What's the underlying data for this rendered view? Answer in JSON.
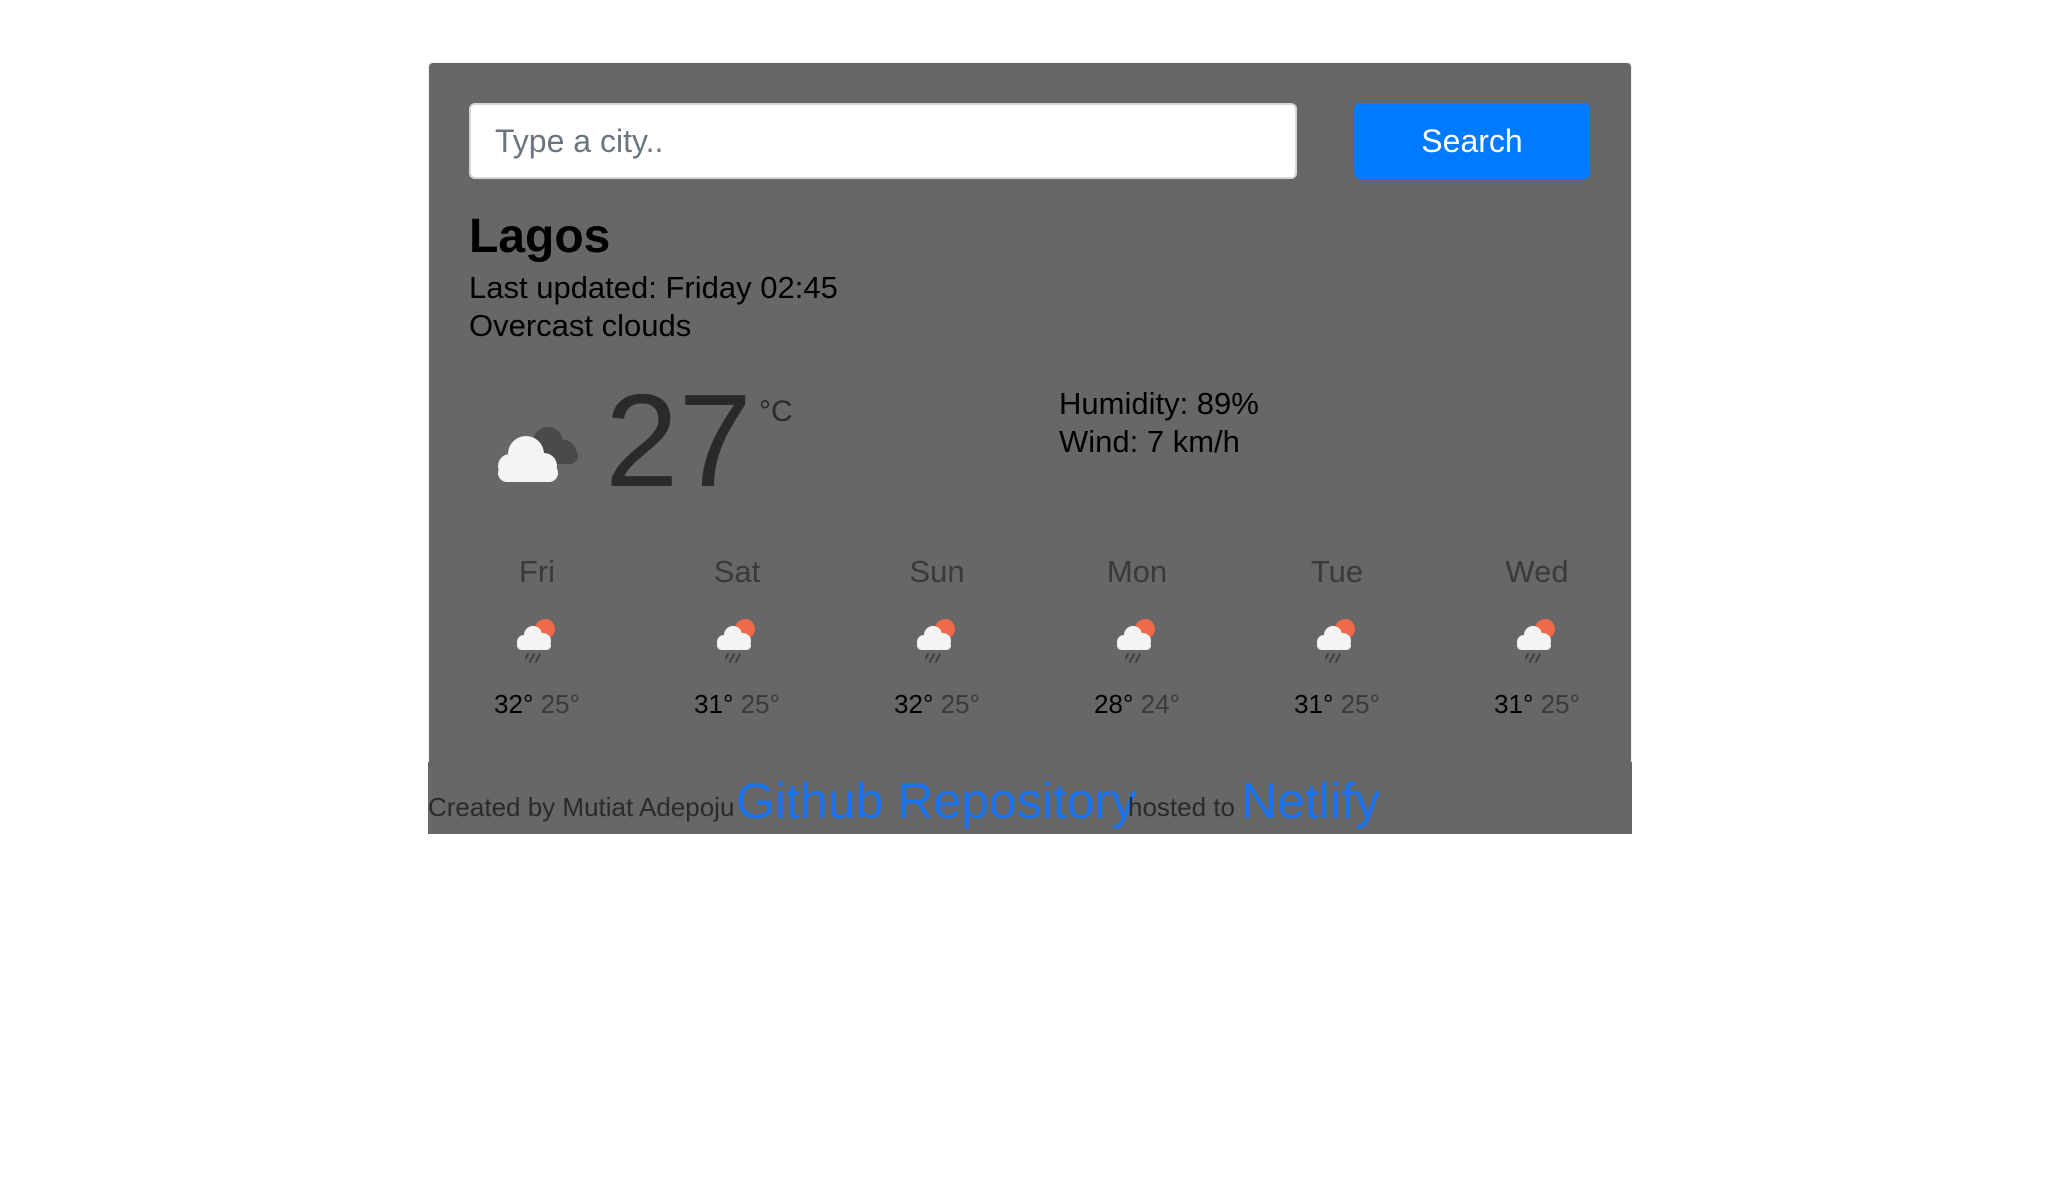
{
  "search": {
    "placeholder": "Type a city..",
    "value": "",
    "button_label": "Search"
  },
  "weather": {
    "city": "Lagos",
    "last_updated": "Last updated: Friday 02:45",
    "description": "Overcast clouds",
    "temperature": "27",
    "unit": "°C",
    "icon": "broken-clouds-icon",
    "humidity": "Humidity: 89%",
    "wind": "Wind: 7 km/h"
  },
  "forecast": [
    {
      "day": "Fri",
      "high": "32°",
      "low": "25°",
      "icon": "rain-sun-icon"
    },
    {
      "day": "Sat",
      "high": "31°",
      "low": "25°",
      "icon": "rain-sun-icon"
    },
    {
      "day": "Sun",
      "high": "32°",
      "low": "25°",
      "icon": "rain-sun-icon"
    },
    {
      "day": "Mon",
      "high": "28°",
      "low": "24°",
      "icon": "rain-sun-icon"
    },
    {
      "day": "Tue",
      "high": "31°",
      "low": "25°",
      "icon": "rain-sun-icon"
    },
    {
      "day": "Wed",
      "high": "31°",
      "low": "25°",
      "icon": "rain-sun-icon"
    }
  ],
  "footer": {
    "created_by": "Created by Mutiat Adepoju",
    "github_link": "Github Repository",
    "hosted_to": "hosted to",
    "netlify_link": "Netlify"
  },
  "colors": {
    "card_background": "#676767",
    "button": "#007bff",
    "link": "#1a73f0",
    "sun": "#ee6a4a"
  }
}
